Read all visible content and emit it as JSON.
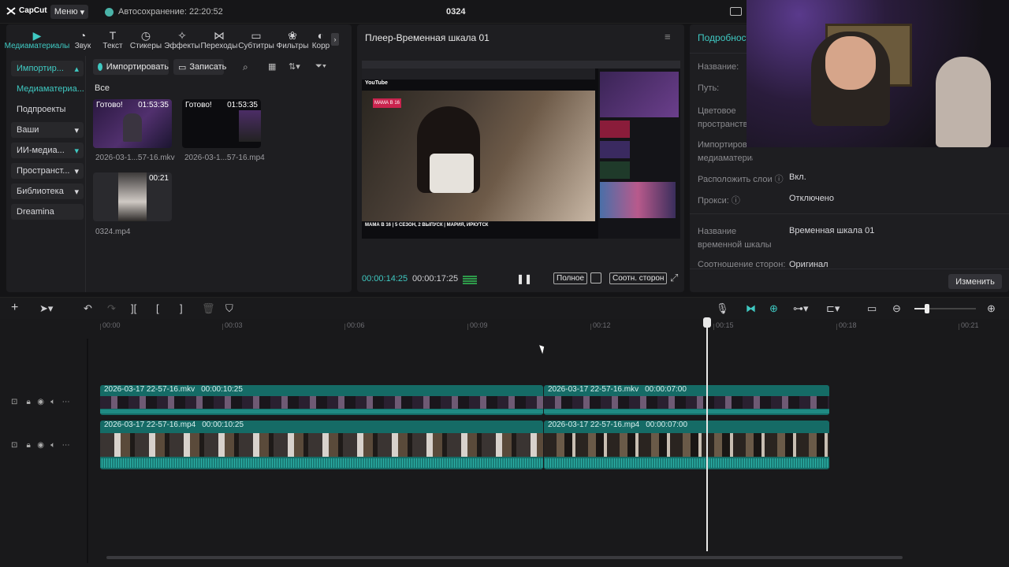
{
  "app": {
    "logo": "CapCut",
    "menu_label": "Меню",
    "autosave": "Автосохранение: 22:20:52",
    "project_title": "0324"
  },
  "media_tabs": [
    {
      "label": "Медиаматериалы",
      "icon": "media-icon"
    },
    {
      "label": "Звук",
      "icon": "audio-icon"
    },
    {
      "label": "Текст",
      "icon": "text-icon"
    },
    {
      "label": "Стикеры",
      "icon": "sticker-icon"
    },
    {
      "label": "Эффекты",
      "icon": "effects-icon"
    },
    {
      "label": "Переходы",
      "icon": "transitions-icon"
    },
    {
      "label": "Субтитры",
      "icon": "subtitles-icon"
    },
    {
      "label": "Фильтры",
      "icon": "filters-icon"
    },
    {
      "label": "Корр",
      "icon": "adjust-icon"
    }
  ],
  "media_sidebar": [
    {
      "label": "Импортир...",
      "style": "box"
    },
    {
      "label": "Медиаматериа...",
      "style": "teal"
    },
    {
      "label": "Подпроекты",
      "style": "plain"
    },
    {
      "label": "Ваши",
      "style": "box"
    },
    {
      "label": "ИИ-медиа...",
      "style": "box"
    },
    {
      "label": "Пространст...",
      "style": "box"
    },
    {
      "label": "Библиотека",
      "style": "box"
    },
    {
      "label": "Dreamina",
      "style": "box"
    }
  ],
  "media_toolbar": {
    "import_label": "Импортировать",
    "record_label": "Записать",
    "filter_label": "Все"
  },
  "media_items": [
    {
      "badge": "Готово!",
      "duration": "01:53:35",
      "name": "2026-03-1...57-16.mkv"
    },
    {
      "badge": "Готово!",
      "duration": "01:53:35",
      "name": "2026-03-1...57-16.mp4"
    },
    {
      "badge": "",
      "duration": "00:21",
      "name": "0324.mp4"
    }
  ],
  "player": {
    "title": "Плеер-Временная шкала 01",
    "current_time": "00:00:14:25",
    "total_time": "00:00:17:25",
    "full_label": "Полное",
    "ratio_label": "Соотн. сторон",
    "video_caption": "МАМА В 16 | 5 СЕЗОН, 2 ВЫПУСК | МАРИЯ, ИРКУТСК",
    "video_brand": "YouTube",
    "video_badge": "МАМА В 16"
  },
  "details": {
    "header": "Подробност",
    "rows": [
      {
        "label": "Название:",
        "value": ""
      },
      {
        "label": "Путь:",
        "value": ""
      },
      {
        "label": "Цветовое пространство:",
        "value": ""
      },
      {
        "label": "Импортировать медиаматериалы:",
        "value": ""
      },
      {
        "label": "Расположить слои",
        "value": "Вкл."
      },
      {
        "label": "Прокси:",
        "value": "Отключено"
      },
      {
        "label": "Название временной шкалы",
        "value": "Временная шкала 01"
      },
      {
        "label": "Соотношение сторон:",
        "value": "Оригинал"
      }
    ],
    "change_label": "Изменить"
  },
  "ruler": [
    "00:00",
    "00:03",
    "00:06",
    "00:09",
    "00:12",
    "00:15",
    "00:18",
    "00:21"
  ],
  "tracks": [
    {
      "clips": [
        {
          "name": "2026-03-17 22-57-16.mkv",
          "duration": "00:00:10:25"
        },
        {
          "name": "2026-03-17 22-57-16.mkv",
          "duration": "00:00:07:00"
        }
      ]
    },
    {
      "clips": [
        {
          "name": "2026-03-17 22-57-16.mp4",
          "duration": "00:00:10:25"
        },
        {
          "name": "2026-03-17 22-57-16.mp4",
          "duration": "00:00:07:00"
        }
      ]
    }
  ],
  "colors": {
    "accent": "#3fc9c2",
    "clip": "#156b66",
    "panel": "#1e1e21"
  }
}
